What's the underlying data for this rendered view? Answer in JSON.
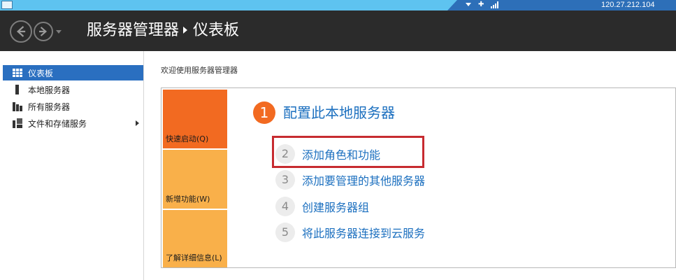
{
  "connection_bar": {
    "ip": "120.27.212.104"
  },
  "header": {
    "title": "服务器管理器",
    "page": "仪表板"
  },
  "sidebar": {
    "items": [
      {
        "label": "仪表板",
        "icon": "dashboard-icon",
        "active": true
      },
      {
        "label": "本地服务器",
        "icon": "server-icon",
        "active": false
      },
      {
        "label": "所有服务器",
        "icon": "servers-icon",
        "active": false
      },
      {
        "label": "文件和存储服务",
        "icon": "storage-icon",
        "active": false,
        "has_arrow": true
      }
    ]
  },
  "main": {
    "welcome": "欢迎使用服务器管理器",
    "tiles": [
      {
        "label": "快速启动(Q)"
      },
      {
        "label": "新增功能(W)"
      },
      {
        "label": "了解详细信息(L)"
      }
    ],
    "primary_step": {
      "number": "1",
      "label": "配置此本地服务器"
    },
    "steps": [
      {
        "number": "2",
        "label": "添加角色和功能"
      },
      {
        "number": "3",
        "label": "添加要管理的其他服务器"
      },
      {
        "number": "4",
        "label": "创建服务器组"
      },
      {
        "number": "5",
        "label": "将此服务器连接到云服务"
      }
    ]
  },
  "colors": {
    "header_bg": "#2b2b2b",
    "accent_blue": "#1b6fbf",
    "tile_orange": "#f26a21",
    "tile_amber": "#f9b04a",
    "highlight_red": "#c72b30"
  }
}
